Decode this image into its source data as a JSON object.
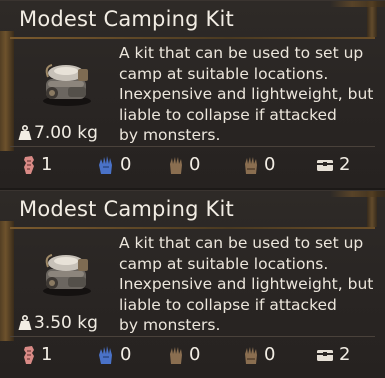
{
  "tooltips": [
    {
      "title": "Modest Camping Kit",
      "description": "A kit that can be used to set up\ncamp at suitable locations.\nInexpensive and lightweight, but\nliable to collapse if attacked\nby monsters.",
      "weight": "7.00 kg",
      "stats": {
        "strength": "1",
        "intellect": "0",
        "dexterity": "0",
        "agility": "0",
        "slots": "2"
      }
    },
    {
      "title": "Modest Camping Kit",
      "description": "A kit that can be used to set up\ncamp at suitable locations.\nInexpensive and lightweight, but\nliable to collapse if attacked\nby monsters.",
      "weight": "3.50 kg",
      "stats": {
        "strength": "1",
        "intellect": "0",
        "dexterity": "0",
        "agility": "0",
        "slots": "2"
      }
    }
  ],
  "icons": {
    "weight": "weight-icon",
    "strength": "strength-fist-icon",
    "intellect": "intellect-hand-icon",
    "dexterity": "dexterity-hand-icon",
    "agility": "agility-hand-icon",
    "slots": "storage-chest-icon",
    "item": "camping-kit-icon"
  },
  "colors": {
    "strength": "#d98a86",
    "intellect": "#4a72c8",
    "dexterity": "#8a6e50",
    "agility": "#8a6e50",
    "slots": "#e6e0d6"
  }
}
